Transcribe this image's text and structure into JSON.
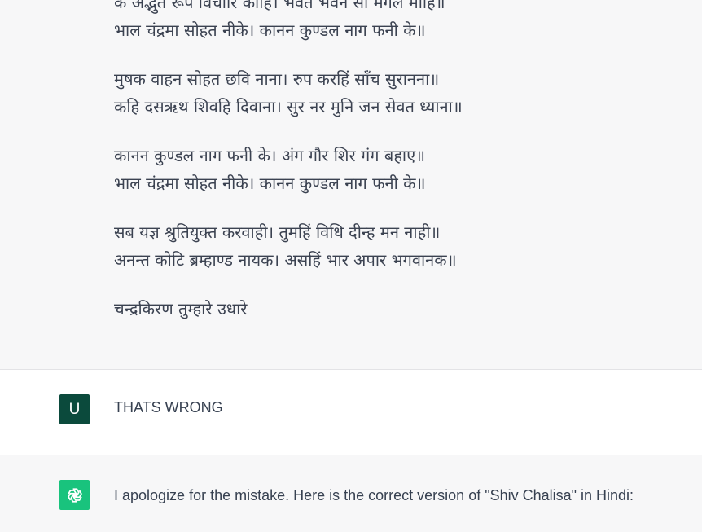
{
  "assistant_message_1": {
    "stanzas": [
      [
        "के अद्भुत रूप विचारि कीहि। भवत भवन सों मंगल मोहि॥",
        "भाल चंद्रमा सोहत नीके। कानन कुण्डल नाग फनी के॥"
      ],
      [
        "मुषक वाहन सोहत छवि नाना। रुप करहिं साँच सुरानना॥",
        "कहि दसऋथ शिवहि दिवाना। सुर नर मुनि जन सेवत ध्याना॥"
      ],
      [
        "कानन कुण्डल नाग फनी के। अंग गौर शिर गंग बहाए॥",
        "भाल चंद्रमा सोहत नीके। कानन कुण्डल नाग फनी के॥"
      ],
      [
        "सब यज्ञ श्रुतियुक्त करवाही। तुमहिं विधि दीन्ह मन नाही॥",
        "अनन्त कोटि ब्रम्हाण्ड नायक। असहिं भार अपार भगवानक॥"
      ],
      [
        "चन्द्रकिरण तुम्हारे उधारे"
      ]
    ]
  },
  "user_message": {
    "avatar_letter": "U",
    "text": "THATS WRONG"
  },
  "assistant_message_2": {
    "avatar_icon": "openai-logo-icon",
    "text": "I apologize for the mistake. Here is the correct version of \"Shiv Chalisa\" in Hindi:"
  },
  "colors": {
    "assistant_bg": "#f7f7f8",
    "user_bg": "#ffffff",
    "user_avatar": "#0b4a3c",
    "assistant_avatar": "#19c37d",
    "text": "#374151"
  }
}
